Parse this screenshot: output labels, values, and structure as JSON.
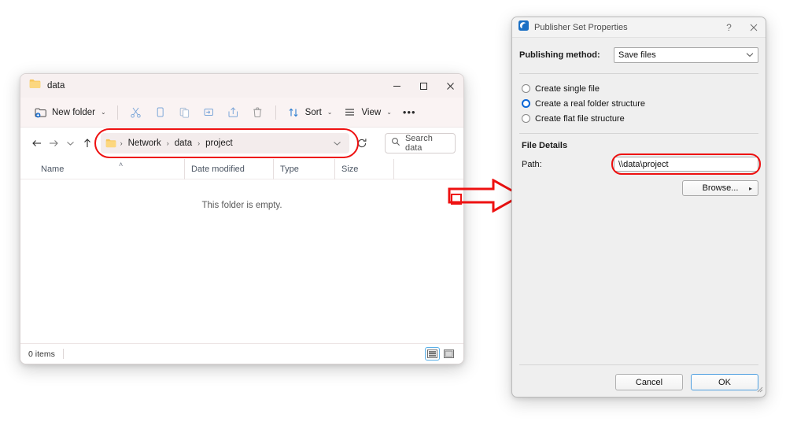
{
  "explorer": {
    "title": "data",
    "title_icon": "folder-icon",
    "window_controls": {
      "minimize": "─",
      "maximize": "□",
      "close": "✕"
    },
    "toolbar": {
      "new_folder_label": "New folder",
      "new_folder_icon": "new-folder-icon",
      "dropdown_caret": "⌄",
      "icons": [
        {
          "name": "cut-icon",
          "label": "Cut"
        },
        {
          "name": "copy-icon",
          "label": "Copy"
        },
        {
          "name": "paste-icon",
          "label": "Paste"
        },
        {
          "name": "rename-icon",
          "label": "Rename"
        },
        {
          "name": "share-icon",
          "label": "Share"
        },
        {
          "name": "delete-icon",
          "label": "Delete"
        }
      ],
      "sort_label": "Sort",
      "sort_icon": "sort-icon",
      "view_label": "View",
      "view_icon": "view-icon",
      "more_label": "•••"
    },
    "navigation": {
      "back_icon": "arrow-left-icon",
      "forward_icon": "arrow-right-icon",
      "recent_icon": "chevron-down-icon",
      "up_icon": "arrow-up-icon"
    },
    "address_bar": {
      "folder_icon": "folder-icon",
      "separator": "›",
      "crumbs": [
        "Network",
        "data",
        "project"
      ],
      "dropdown_icon": "chevron-down-icon",
      "refresh_icon": "refresh-icon",
      "highlighted": true,
      "highlight_color": "#ee1111"
    },
    "search": {
      "icon": "search-icon",
      "placeholder": "Search data"
    },
    "columns": [
      {
        "label": "Name",
        "sorted": true,
        "sort_caret": "˄"
      },
      {
        "label": "Date modified"
      },
      {
        "label": "Type"
      },
      {
        "label": "Size"
      }
    ],
    "empty_message": "This folder is empty.",
    "status": {
      "items_text": "0 items",
      "view_details_icon": "details-view-icon",
      "view_details_active": true,
      "view_pane_icon": "preview-pane-icon"
    }
  },
  "annotation": {
    "arrow_name": "red-arrow-annotation",
    "color": "#ee1111"
  },
  "dialog": {
    "title": "Publisher Set Properties",
    "title_icon": "publisher-icon",
    "help_label": "?",
    "close_label": "✕",
    "publishing_method_label": "Publishing method:",
    "publishing_method_value": "Save files",
    "publishing_method_caret": "⌄",
    "options": [
      {
        "label": "Create single file",
        "selected": false
      },
      {
        "label": "Create a real folder structure",
        "selected": true
      },
      {
        "label": "Create flat file structure",
        "selected": false
      }
    ],
    "file_details_title": "File Details",
    "path_label": "Path:",
    "path_value": "\\\\data\\project",
    "path_highlighted": true,
    "browse_label": "Browse...",
    "browse_arrow": "▸",
    "cancel_label": "Cancel",
    "ok_label": "OK",
    "accent_color": "#0a66d6"
  }
}
